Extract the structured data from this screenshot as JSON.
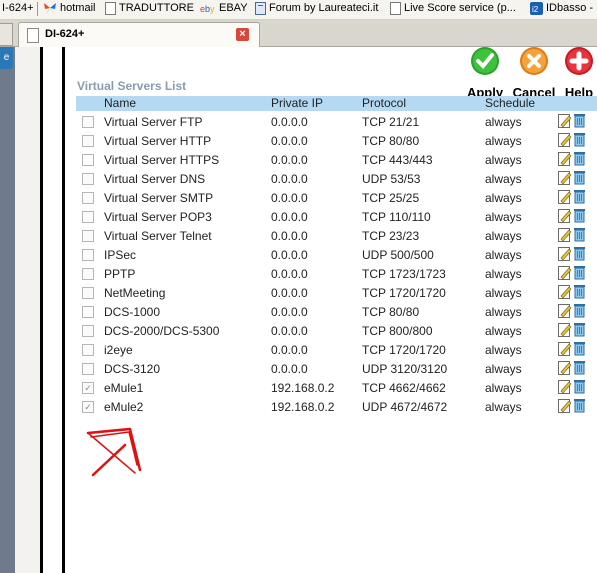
{
  "bookmarks": [
    {
      "label": "I-624+",
      "icon": "none"
    },
    {
      "label": "hotmail",
      "icon": "butterfly-icon"
    },
    {
      "label": "TRADUTTORE",
      "icon": "page-icon"
    },
    {
      "label": "EBAY",
      "icon": "ebay-icon"
    },
    {
      "label": "Forum by Laureateci.it",
      "icon": "bookmark-icon"
    },
    {
      "label": "Live Score service (p...",
      "icon": "page-icon"
    },
    {
      "label": "IDbasso -",
      "icon": "logo-icon"
    }
  ],
  "tab": {
    "title": "DI-624+",
    "close": "×"
  },
  "sidebar_button": "e",
  "actions": [
    {
      "label": "Apply",
      "icon": "check-icon",
      "color": "#2ea02e"
    },
    {
      "label": "Cancel",
      "icon": "cancel-icon",
      "color": "#f08a24"
    },
    {
      "label": "Help",
      "icon": "help-icon",
      "color": "#d8242c"
    }
  ],
  "list": {
    "title": "Virtual Servers List",
    "columns": [
      "Name",
      "Private IP",
      "Protocol",
      "Schedule"
    ],
    "rows": [
      {
        "checked": false,
        "name": "Virtual Server FTP",
        "ip": "0.0.0.0",
        "protocol": "TCP 21/21",
        "schedule": "always"
      },
      {
        "checked": false,
        "name": "Virtual Server HTTP",
        "ip": "0.0.0.0",
        "protocol": "TCP 80/80",
        "schedule": "always"
      },
      {
        "checked": false,
        "name": "Virtual Server HTTPS",
        "ip": "0.0.0.0",
        "protocol": "TCP 443/443",
        "schedule": "always"
      },
      {
        "checked": false,
        "name": "Virtual Server DNS",
        "ip": "0.0.0.0",
        "protocol": "UDP 53/53",
        "schedule": "always"
      },
      {
        "checked": false,
        "name": "Virtual Server SMTP",
        "ip": "0.0.0.0",
        "protocol": "TCP 25/25",
        "schedule": "always"
      },
      {
        "checked": false,
        "name": "Virtual Server POP3",
        "ip": "0.0.0.0",
        "protocol": "TCP 110/110",
        "schedule": "always"
      },
      {
        "checked": false,
        "name": "Virtual Server Telnet",
        "ip": "0.0.0.0",
        "protocol": "TCP 23/23",
        "schedule": "always"
      },
      {
        "checked": false,
        "name": "IPSec",
        "ip": "0.0.0.0",
        "protocol": "UDP 500/500",
        "schedule": "always"
      },
      {
        "checked": false,
        "name": "PPTP",
        "ip": "0.0.0.0",
        "protocol": "TCP 1723/1723",
        "schedule": "always"
      },
      {
        "checked": false,
        "name": "NetMeeting",
        "ip": "0.0.0.0",
        "protocol": "TCP 1720/1720",
        "schedule": "always"
      },
      {
        "checked": false,
        "name": "DCS-1000",
        "ip": "0.0.0.0",
        "protocol": "TCP 80/80",
        "schedule": "always"
      },
      {
        "checked": false,
        "name": "DCS-2000/DCS-5300",
        "ip": "0.0.0.0",
        "protocol": "TCP 800/800",
        "schedule": "always"
      },
      {
        "checked": false,
        "name": "i2eye",
        "ip": "0.0.0.0",
        "protocol": "TCP 1720/1720",
        "schedule": "always"
      },
      {
        "checked": false,
        "name": "DCS-3120",
        "ip": "0.0.0.0",
        "protocol": "UDP 3120/3120",
        "schedule": "always"
      },
      {
        "checked": true,
        "name": "eMule1",
        "ip": "192.168.0.2",
        "protocol": "TCP 4662/4662",
        "schedule": "always"
      },
      {
        "checked": true,
        "name": "eMule2",
        "ip": "192.168.0.2",
        "protocol": "UDP 4672/4672",
        "schedule": "always"
      }
    ]
  },
  "annotation": {
    "icon": "red-arrow-icon",
    "color": "#e01010"
  }
}
